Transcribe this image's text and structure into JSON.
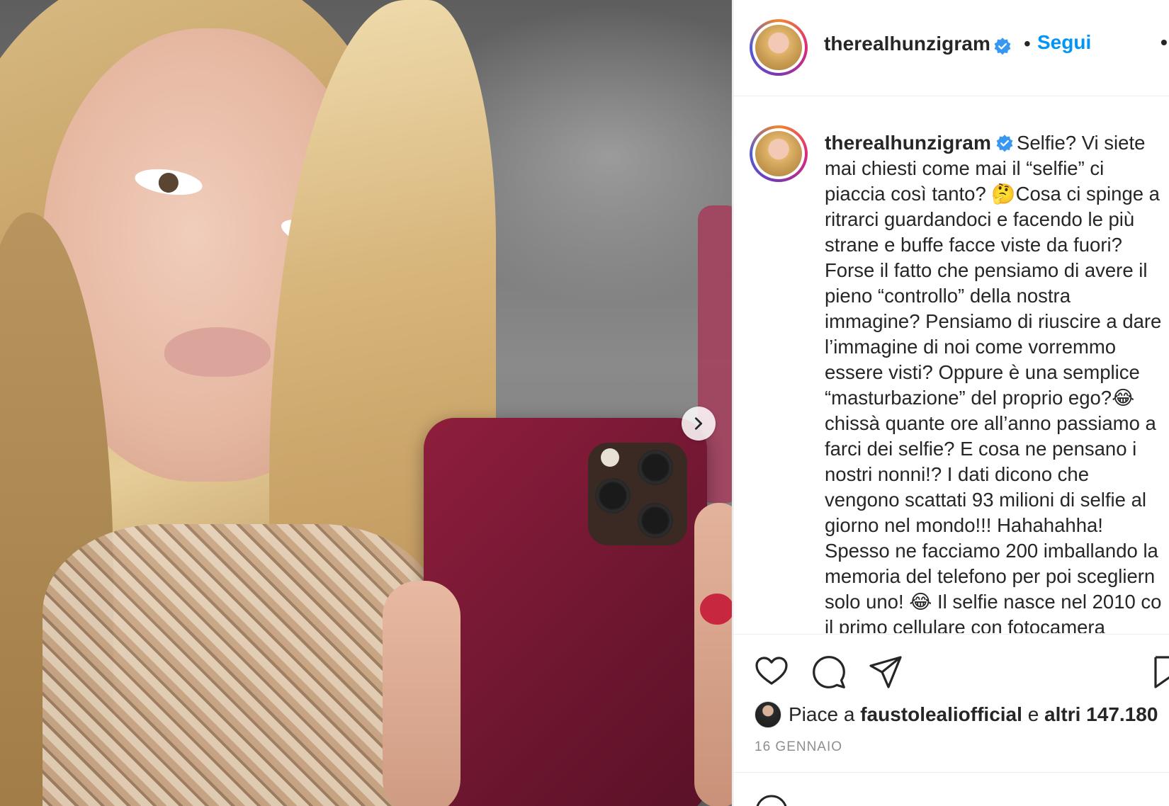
{
  "post": {
    "username": "therealhunzigram",
    "follow_label": "Segui",
    "separator": "•",
    "more_label": "•",
    "caption_username": "therealhunzigram",
    "caption_text": "Selfie? Vi siete\nmai chiesti come mai il “selfie” ci\npiaccia così tanto? 🤔Cosa ci spinge a\nritrarci guardandoci e facendo le più\nstrane e buffe facce viste da fuori?\nForse il fatto che pensiamo di avere il\npieno “controllo” della nostra\nimmagine? Pensiamo di riuscire a dare\nl’immagine di noi come vorremmo\nessere visti? Oppure è una semplice\n“masturbazione” del proprio ego?😂\nchissà quante ore all’anno passiamo a\nfarci dei selfie? E cosa ne pensano i\nnostri nonni!? I dati dicono che\nvengono scattati 93 milioni di selfie al\ngiorno nel mondo!!! Hahahahha!\nSpesso ne facciamo 200 imballando la\nmemoria del telefono per poi scegliern\nsolo uno! 😂 Il selfie nasce nel 2010 co\nil primo cellulare con fotocamera",
    "likes_prefix": "Piace a",
    "likes_user": "faustolealiofficial",
    "likes_conj": "e",
    "likes_others": "altri 147.180",
    "date": "16 GENNAIO"
  },
  "icons": {
    "verified": "verified-badge-icon",
    "like": "heart-icon",
    "comment": "comment-bubble-icon",
    "share": "paper-plane-icon",
    "save": "bookmark-icon",
    "next": "chevron-right-icon",
    "emoji": "emoji-icon"
  },
  "colors": {
    "accent": "#0095f6",
    "text": "#262626",
    "muted": "#8e8e8e",
    "border": "#dbdbdb",
    "verified": "#3897f0"
  }
}
